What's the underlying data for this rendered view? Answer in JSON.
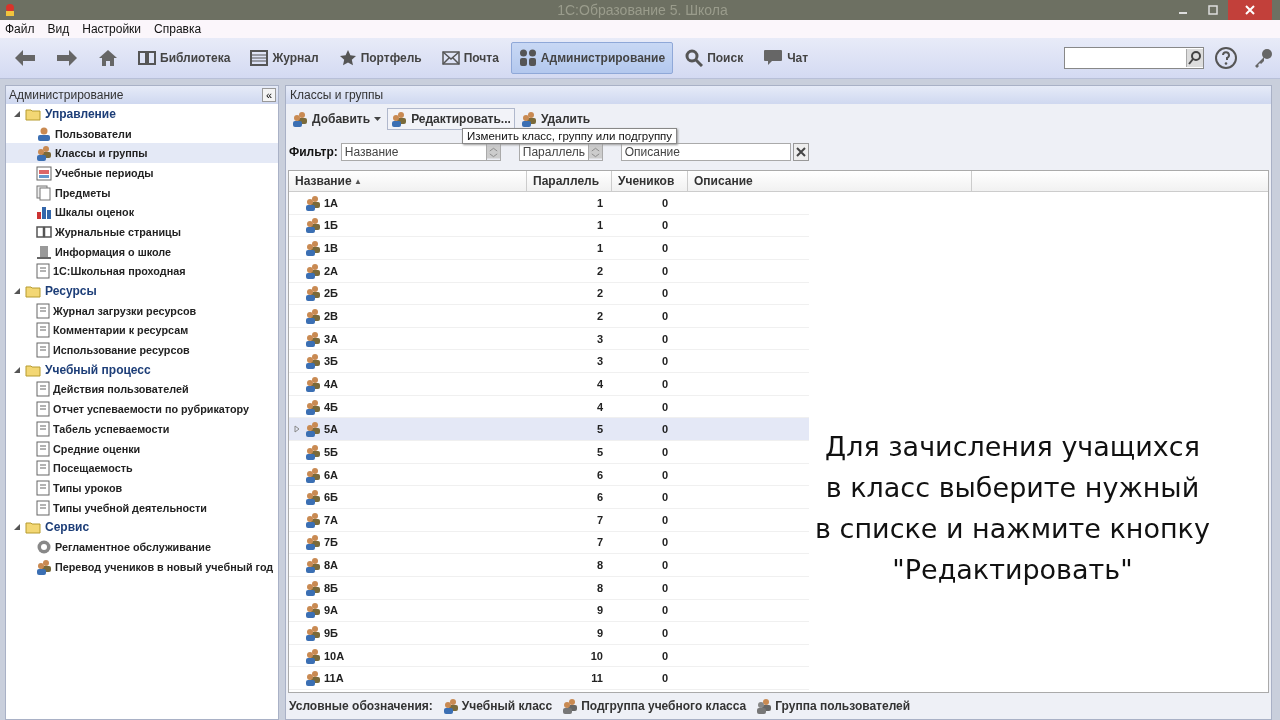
{
  "window": {
    "title": "1С:Образование 5. Школа"
  },
  "menu": [
    "Файл",
    "Вид",
    "Настройки",
    "Справка"
  ],
  "toolbar": [
    {
      "kind": "back",
      "selected": false
    },
    {
      "kind": "forward",
      "selected": false
    },
    {
      "kind": "home",
      "selected": false
    },
    {
      "kind": "book",
      "label": "Библиотека",
      "selected": false
    },
    {
      "kind": "journal",
      "label": "Журнал",
      "selected": false
    },
    {
      "kind": "star",
      "label": "Портфель",
      "selected": false
    },
    {
      "kind": "mail",
      "label": "Почта",
      "selected": false
    },
    {
      "kind": "admin",
      "label": "Администрирование",
      "selected": true
    },
    {
      "kind": "search",
      "label": "Поиск",
      "selected": false
    },
    {
      "kind": "chat",
      "label": "Чат",
      "selected": false
    }
  ],
  "sidebar": {
    "title": "Администрирование",
    "collapse": "«",
    "groups": [
      {
        "label": "Управление",
        "expanded": true,
        "children": [
          {
            "label": "Пользователи",
            "kind": "user",
            "selected": false
          },
          {
            "label": "Классы и группы",
            "kind": "group",
            "selected": true
          },
          {
            "label": "Учебные периоды",
            "kind": "calendar",
            "selected": false
          },
          {
            "label": "Предметы",
            "kind": "pages",
            "selected": false
          },
          {
            "label": "Шкалы оценок",
            "kind": "chart",
            "selected": false
          },
          {
            "label": "Журнальные страницы",
            "kind": "book",
            "selected": false
          },
          {
            "label": "Информация о школе",
            "kind": "building",
            "selected": false
          },
          {
            "label": "1С:Школьная проходная",
            "kind": "doc",
            "selected": false
          }
        ]
      },
      {
        "label": "Ресурсы",
        "expanded": true,
        "children": [
          {
            "label": "Журнал загрузки ресурсов",
            "kind": "doc",
            "selected": false
          },
          {
            "label": "Комментарии к ресурсам",
            "kind": "doc",
            "selected": false
          },
          {
            "label": "Использование ресурсов",
            "kind": "doc",
            "selected": false
          }
        ]
      },
      {
        "label": "Учебный процесс",
        "expanded": true,
        "children": [
          {
            "label": "Действия пользователей",
            "kind": "doc",
            "selected": false
          },
          {
            "label": "Отчет успеваемости по рубрикатору",
            "kind": "doc",
            "selected": false
          },
          {
            "label": "Табель успеваемости",
            "kind": "doc",
            "selected": false
          },
          {
            "label": "Средние оценки",
            "kind": "doc",
            "selected": false
          },
          {
            "label": "Посещаемость",
            "kind": "doc",
            "selected": false
          },
          {
            "label": "Типы уроков",
            "kind": "doc",
            "selected": false
          },
          {
            "label": "Типы учебной деятельности",
            "kind": "doc",
            "selected": false
          }
        ]
      },
      {
        "label": "Сервис",
        "expanded": true,
        "children": [
          {
            "label": "Регламентное обслуживание",
            "kind": "service",
            "selected": false
          },
          {
            "label": "Перевод учеников в новый учебный год",
            "kind": "group",
            "selected": false
          }
        ]
      }
    ]
  },
  "panel": {
    "title": "Классы и группы",
    "actions": [
      {
        "label": "Добавить",
        "dropdown": true
      },
      {
        "label": "Редактировать...",
        "dropdown": false
      },
      {
        "label": "Удалить",
        "dropdown": false
      }
    ],
    "tooltip": "Изменить класс, группу или подгруппу",
    "filter": {
      "label": "Фильтр:",
      "fields": [
        {
          "placeholder": "Название"
        },
        {
          "placeholder": "Параллель"
        },
        {
          "placeholder": "Описание"
        }
      ]
    },
    "table": {
      "columns": [
        "Название",
        "Параллель",
        "Учеников",
        "Описание"
      ],
      "sort_arrow": "▲",
      "rows": [
        {
          "name": "1А",
          "parallel": "1",
          "students": "0",
          "selected": false
        },
        {
          "name": "1Б",
          "parallel": "1",
          "students": "0",
          "selected": false
        },
        {
          "name": "1В",
          "parallel": "1",
          "students": "0",
          "selected": false
        },
        {
          "name": "2А",
          "parallel": "2",
          "students": "0",
          "selected": false
        },
        {
          "name": "2Б",
          "parallel": "2",
          "students": "0",
          "selected": false
        },
        {
          "name": "2В",
          "parallel": "2",
          "students": "0",
          "selected": false
        },
        {
          "name": "3А",
          "parallel": "3",
          "students": "0",
          "selected": false
        },
        {
          "name": "3Б",
          "parallel": "3",
          "students": "0",
          "selected": false
        },
        {
          "name": "4А",
          "parallel": "4",
          "students": "0",
          "selected": false
        },
        {
          "name": "4Б",
          "parallel": "4",
          "students": "0",
          "selected": false
        },
        {
          "name": "5А",
          "parallel": "5",
          "students": "0",
          "selected": true
        },
        {
          "name": "5Б",
          "parallel": "5",
          "students": "0",
          "selected": false
        },
        {
          "name": "6А",
          "parallel": "6",
          "students": "0",
          "selected": false
        },
        {
          "name": "6Б",
          "parallel": "6",
          "students": "0",
          "selected": false
        },
        {
          "name": "7А",
          "parallel": "7",
          "students": "0",
          "selected": false
        },
        {
          "name": "7Б",
          "parallel": "7",
          "students": "0",
          "selected": false
        },
        {
          "name": "8А",
          "parallel": "8",
          "students": "0",
          "selected": false
        },
        {
          "name": "8Б",
          "parallel": "8",
          "students": "0",
          "selected": false
        },
        {
          "name": "9А",
          "parallel": "9",
          "students": "0",
          "selected": false
        },
        {
          "name": "9Б",
          "parallel": "9",
          "students": "0",
          "selected": false
        },
        {
          "name": "10А",
          "parallel": "10",
          "students": "0",
          "selected": false
        },
        {
          "name": "11А",
          "parallel": "11",
          "students": "0",
          "selected": false
        }
      ]
    },
    "legend": {
      "label": "Условные обозначения:",
      "items": [
        "Учебный класс",
        "Подгруппа учебного класса",
        "Группа пользователей"
      ]
    }
  },
  "caption": [
    "Для зачисления учащихся",
    "в класс выберите нужный",
    "в списке и нажмите кнопку",
    "\"Редактировать\""
  ]
}
